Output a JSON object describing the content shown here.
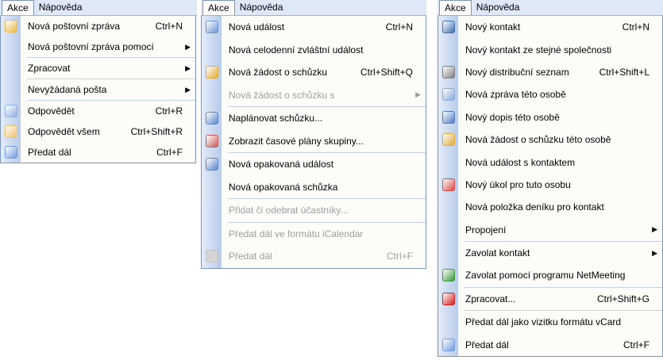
{
  "colors": {
    "menubar": "#dfe8f6",
    "menu_bg": "#fcfcf9",
    "border": "#7a95c1",
    "disabled_text": "#9d9d9d"
  },
  "panels": [
    {
      "menubar": [
        "Akce",
        "Nápověda"
      ],
      "items": [
        {
          "label": "Nová poštovní zpráva",
          "shortcut": "Ctrl+N",
          "icon": "new-mail-icon"
        },
        {
          "label": "Nová poštovní zpráva pomocí",
          "submenu": true
        },
        {
          "sep": true
        },
        {
          "label": "Zpracovat",
          "submenu": true
        },
        {
          "sep": true
        },
        {
          "label": "Nevyžádaná pošta",
          "submenu": true
        },
        {
          "sep": true
        },
        {
          "label": "Odpovědět",
          "shortcut": "Ctrl+R",
          "icon": "reply-icon"
        },
        {
          "label": "Odpovědět všem",
          "shortcut": "Ctrl+Shift+R",
          "icon": "reply-all-icon"
        },
        {
          "label": "Předat dál",
          "shortcut": "Ctrl+F",
          "icon": "forward-icon"
        }
      ]
    },
    {
      "menubar": [
        "Akce",
        "Nápověda"
      ],
      "items": [
        {
          "label": "Nová událost",
          "shortcut": "Ctrl+N",
          "icon": "calendar-event-icon"
        },
        {
          "label": "Nová celodenní zvláštní událost"
        },
        {
          "label": "Nová žádost o schůzku",
          "shortcut": "Ctrl+Shift+Q",
          "icon": "meeting-request-icon"
        },
        {
          "label": "Nová žádost o schůzku s",
          "submenu": true,
          "disabled": true
        },
        {
          "sep": true
        },
        {
          "label": "Naplánovat schůzku...",
          "icon": "plan-meeting-icon"
        },
        {
          "label": "Zobrazit časové plány skupiny...",
          "icon": "group-schedule-icon"
        },
        {
          "sep": true
        },
        {
          "label": "Nová opakovaná událost",
          "icon": "recurring-event-icon"
        },
        {
          "label": "Nová opakovaná schůzka"
        },
        {
          "sep": true
        },
        {
          "label": "Přidat či odebrat účastníky...",
          "disabled": true
        },
        {
          "sep": true
        },
        {
          "label": "Předat dál ve formátu iCalendar",
          "disabled": true
        },
        {
          "label": "Předat dál",
          "shortcut": "Ctrl+F",
          "disabled": true,
          "icon": "forward-icon"
        }
      ]
    },
    {
      "menubar": [
        "Akce",
        "Nápověda"
      ],
      "items": [
        {
          "label": "Nový kontakt",
          "shortcut": "Ctrl+N",
          "icon": "contact-card-icon"
        },
        {
          "label": "Nový kontakt ze stejné společnosti"
        },
        {
          "label": "Nový distribuční seznam",
          "shortcut": "Ctrl+Shift+L",
          "icon": "distribution-list-icon"
        },
        {
          "label": "Nová zpráva této osobě",
          "icon": "message-to-contact-icon"
        },
        {
          "label": "Nový dopis této osobě",
          "icon": "letter-icon"
        },
        {
          "label": "Nová žádost o schůzku této osobě",
          "icon": "meeting-request-icon"
        },
        {
          "label": "Nová událost s kontaktem"
        },
        {
          "label": "Nový úkol pro tuto osobu",
          "icon": "task-icon"
        },
        {
          "label": "Nová položka deníku pro kontakt"
        },
        {
          "label": "Propojení",
          "submenu": true
        },
        {
          "sep": true
        },
        {
          "label": "Zavolat kontakt",
          "submenu": true
        },
        {
          "label": "Zavolat pomocí programu NetMeeting",
          "icon": "netmeeting-icon"
        },
        {
          "sep": true
        },
        {
          "label": "Zpracovat...",
          "shortcut": "Ctrl+Shift+G",
          "icon": "flag-icon"
        },
        {
          "sep": true
        },
        {
          "label": "Předat dál jako vizitku formátu vCard"
        },
        {
          "label": "Předat dál",
          "shortcut": "Ctrl+F",
          "icon": "forward-icon"
        }
      ]
    }
  ]
}
